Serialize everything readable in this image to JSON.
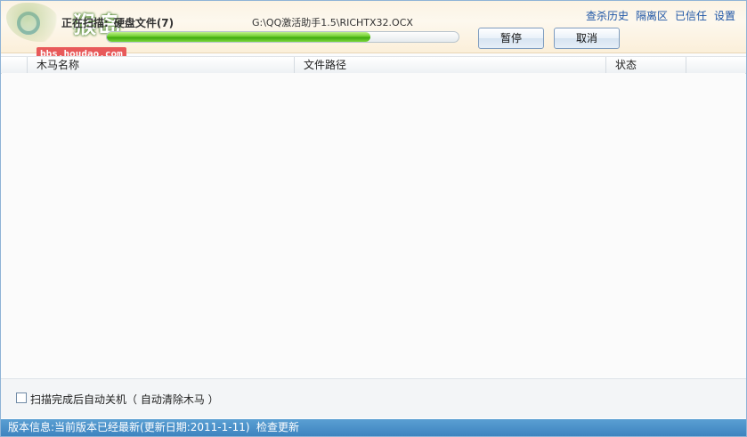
{
  "watermark": {
    "logo_text": "猴岛",
    "site": "bbs.houdao.com"
  },
  "scan": {
    "status_prefix": "正在扫描:",
    "target": "硬盘文件(7)",
    "current_file": "G:\\QQ激活助手1.5\\RICHTX32.OCX",
    "progress_fraction": 0.75
  },
  "buttons": {
    "pause": "暂停",
    "cancel": "取消"
  },
  "links": {
    "history": "查杀历史",
    "quarantine": "隔离区",
    "trusted": "已信任",
    "settings": "设置"
  },
  "table": {
    "columns": [
      "木马名称",
      "文件路径",
      "状态"
    ],
    "rows": []
  },
  "options": {
    "auto_shutdown_label": "扫描完成后自动关机（ 自动清除木马 ）",
    "auto_shutdown_checked": false
  },
  "statusbar": {
    "version_info": "版本信息:当前版本已经最新(更新日期:2011-1-11)",
    "check_update": "检查更新"
  },
  "colors": {
    "accent": "#3e84bf",
    "link": "#1f56a6",
    "progress": "#3ea70f"
  }
}
